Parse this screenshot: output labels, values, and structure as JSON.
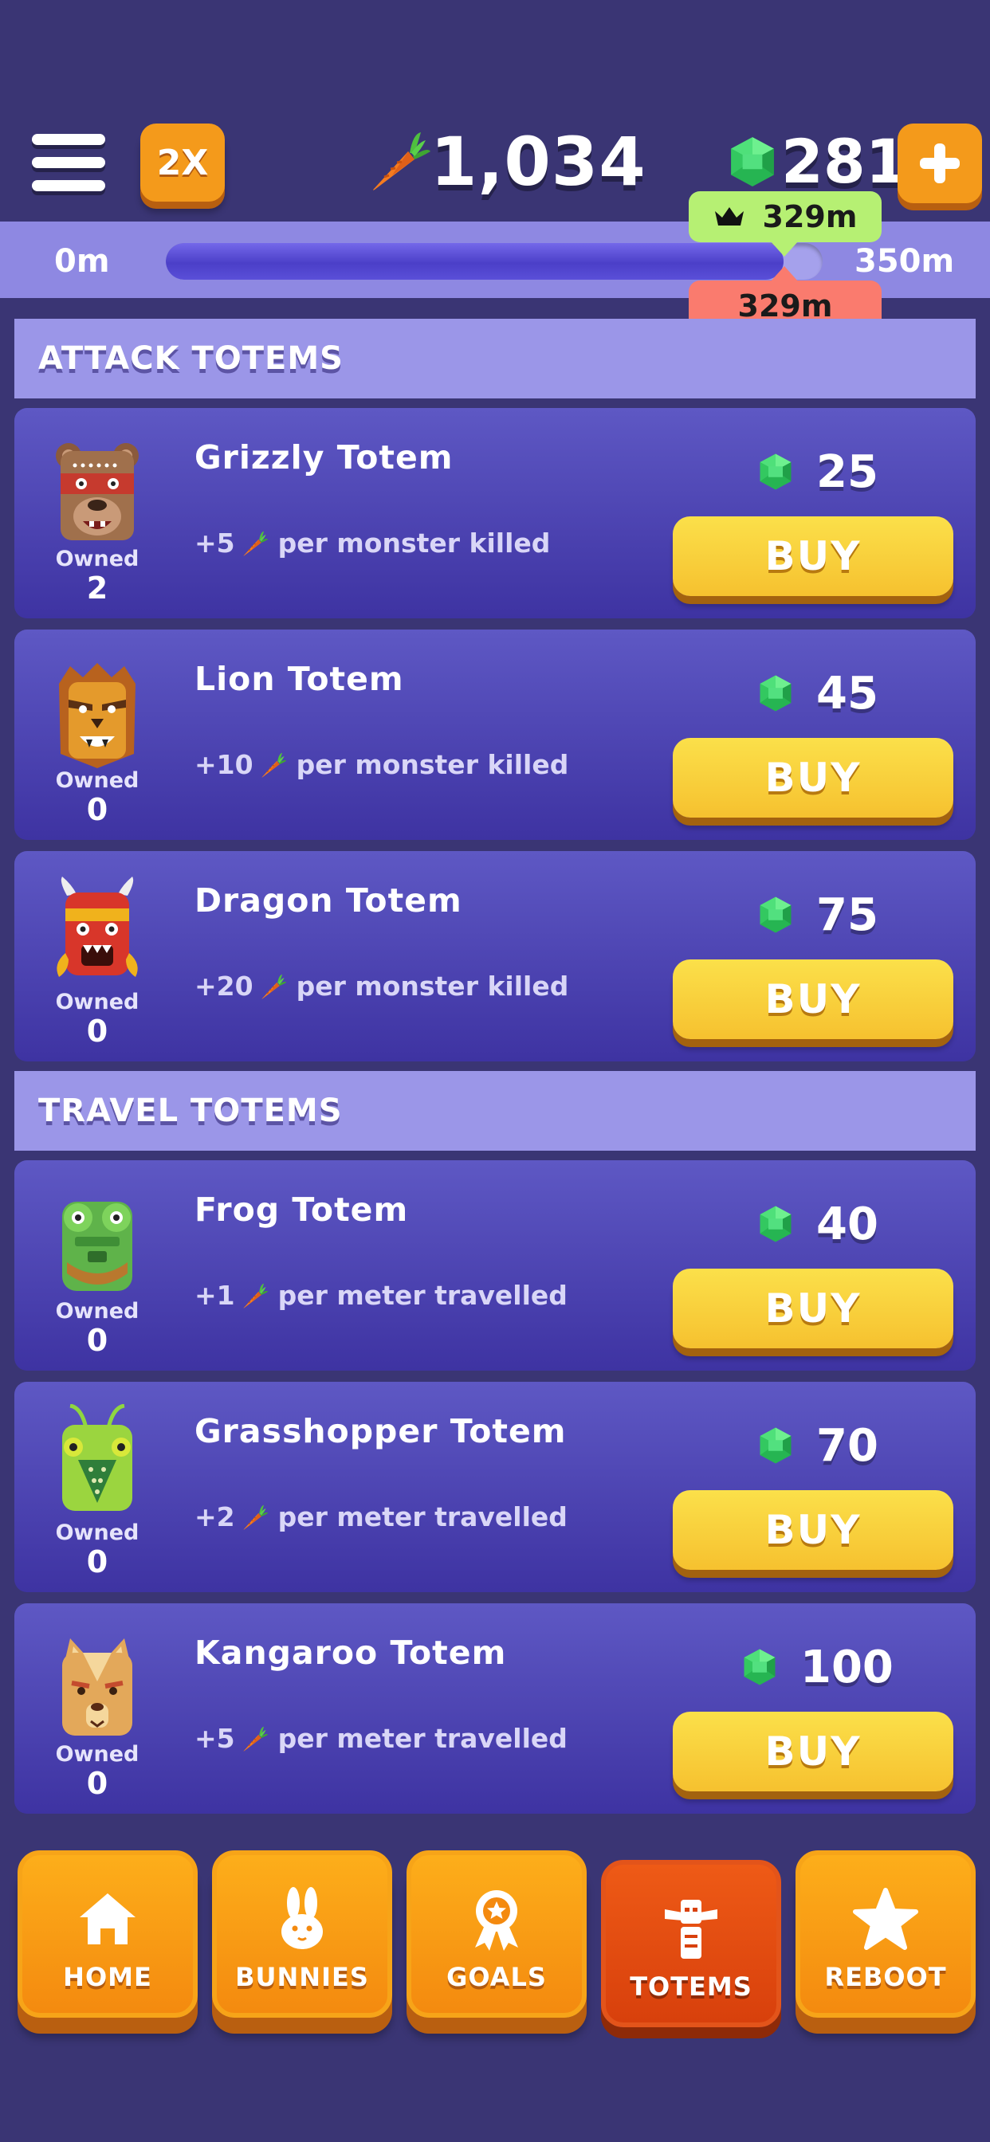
{
  "header": {
    "menu_icon": "hamburger-menu-icon",
    "multiplier_label": "2X",
    "carrots": "1,034",
    "gems": "281",
    "add_gems_icon": "plus-icon"
  },
  "progress": {
    "start_label": "0m",
    "end_label": "350m",
    "best_label": "329m",
    "current_label": "329m",
    "fraction": 0.94
  },
  "sections": {
    "attack_title": "ATTACK TOTEMS",
    "travel_title": "TRAVEL TOTEMS"
  },
  "owned_label": "Owned",
  "buy_label": "BUY",
  "totems": [
    {
      "icon": "grizzly-totem-icon",
      "name": "Grizzly Totem",
      "amount": "+5",
      "effect": "per monster killed",
      "price": "25",
      "owned": "2"
    },
    {
      "icon": "lion-totem-icon",
      "name": "Lion Totem",
      "amount": "+10",
      "effect": "per monster killed",
      "price": "45",
      "owned": "0"
    },
    {
      "icon": "dragon-totem-icon",
      "name": "Dragon Totem",
      "amount": "+20",
      "effect": "per monster killed",
      "price": "75",
      "owned": "0"
    },
    {
      "icon": "frog-totem-icon",
      "name": "Frog Totem",
      "amount": "+1",
      "effect": "per meter travelled",
      "price": "40",
      "owned": "0"
    },
    {
      "icon": "grasshopper-totem-icon",
      "name": "Grasshopper Totem",
      "amount": "+2",
      "effect": "per meter travelled",
      "price": "70",
      "owned": "0"
    },
    {
      "icon": "kangaroo-totem-icon",
      "name": "Kangaroo Totem",
      "amount": "+5",
      "effect": "per meter travelled",
      "price": "100",
      "owned": "0"
    }
  ],
  "nav": [
    {
      "icon": "home-icon",
      "label": "HOME",
      "active": false
    },
    {
      "icon": "bunny-icon",
      "label": "BUNNIES",
      "active": false
    },
    {
      "icon": "award-ribbon-icon",
      "label": "GOALS",
      "active": false
    },
    {
      "icon": "totem-icon",
      "label": "TOTEMS",
      "active": true
    },
    {
      "icon": "star-icon",
      "label": "REBOOT",
      "active": false
    }
  ],
  "colors": {
    "background": "#3a3574",
    "accent_orange": "#f49a1b",
    "buy_yellow": "#f6c12f",
    "gem_green": "#3ccf6a",
    "best_tag": "#b6f073",
    "current_tag": "#fa7b6e"
  }
}
